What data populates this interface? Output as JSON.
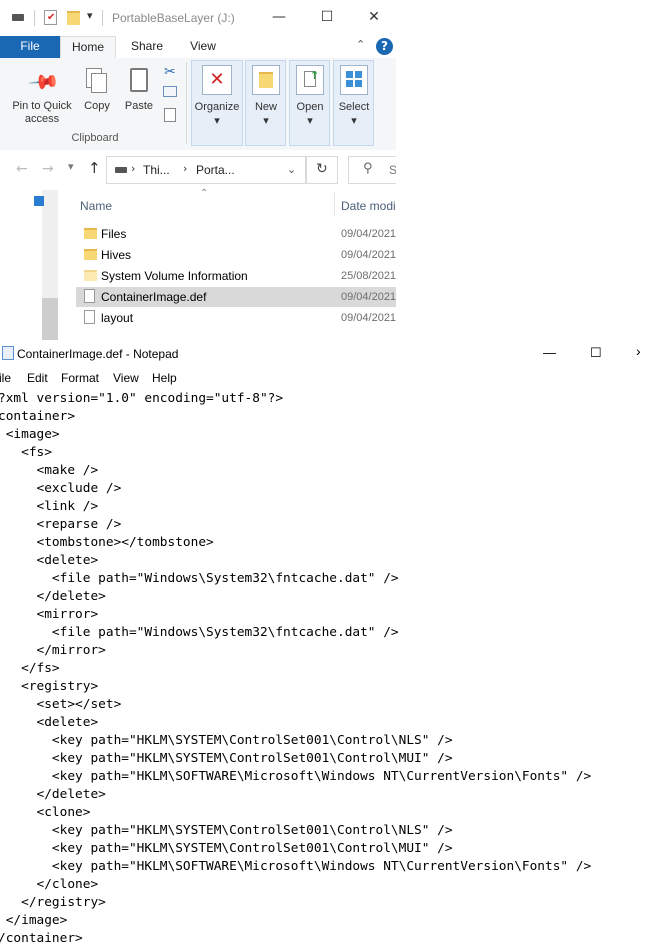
{
  "explorer": {
    "window_title": "PortableBaseLayer (J:)",
    "caption": {
      "minimize": "—",
      "maximize": "☐",
      "close": "✕"
    },
    "tabs": [
      "File",
      "Home",
      "Share",
      "View"
    ],
    "ribbon": {
      "pin_label_1": "Pin to Quick",
      "pin_label_2": "access",
      "copy": "Copy",
      "paste": "Paste",
      "clipboard_group": "Clipboard",
      "organize": "Organize",
      "new": "New",
      "open": "Open",
      "select": "Select",
      "dropdown_glyph": "▾"
    },
    "address": {
      "path_this": "Thi...",
      "path_drive": "Porta...",
      "separator": "›",
      "search_placeholder": "S"
    },
    "columns": {
      "name": "Name",
      "date": "Date modi"
    },
    "files": [
      {
        "name": "Files",
        "date": "09/04/2021",
        "type": "folder"
      },
      {
        "name": "Hives",
        "date": "09/04/2021",
        "type": "folder"
      },
      {
        "name": "System Volume Information",
        "date": "25/08/2021",
        "type": "folder-light"
      },
      {
        "name": "ContainerImage.def",
        "date": "09/04/2021",
        "type": "file",
        "selected": true
      },
      {
        "name": "layout",
        "date": "09/04/2021",
        "type": "file"
      }
    ]
  },
  "notepad": {
    "title": "ContainerImage.def - Notepad",
    "caption": {
      "minimize": "—",
      "maximize": "☐",
      "close": "✕"
    },
    "menu": [
      "ile",
      "Edit",
      "Format",
      "View",
      "Help"
    ],
    "lines": [
      "?xml version=\"1.0\" encoding=\"utf-8\"?>",
      "container>",
      " <image>",
      "   <fs>",
      "     <make />",
      "     <exclude />",
      "     <link />",
      "     <reparse />",
      "     <tombstone></tombstone>",
      "     <delete>",
      "       <file path=\"Windows\\System32\\fntcache.dat\" />",
      "     </delete>",
      "     <mirror>",
      "       <file path=\"Windows\\System32\\fntcache.dat\" />",
      "     </mirror>",
      "   </fs>",
      "   <registry>",
      "     <set></set>",
      "     <delete>",
      "       <key path=\"HKLM\\SYSTEM\\ControlSet001\\Control\\NLS\" />",
      "       <key path=\"HKLM\\SYSTEM\\ControlSet001\\Control\\MUI\" />",
      "       <key path=\"HKLM\\SOFTWARE\\Microsoft\\Windows NT\\CurrentVersion\\Fonts\" />",
      "     </delete>",
      "     <clone>",
      "       <key path=\"HKLM\\SYSTEM\\ControlSet001\\Control\\NLS\" />",
      "       <key path=\"HKLM\\SYSTEM\\ControlSet001\\Control\\MUI\" />",
      "       <key path=\"HKLM\\SOFTWARE\\Microsoft\\Windows NT\\CurrentVersion\\Fonts\" />",
      "     </clone>",
      "   </registry>",
      " </image>",
      "/container>"
    ]
  }
}
